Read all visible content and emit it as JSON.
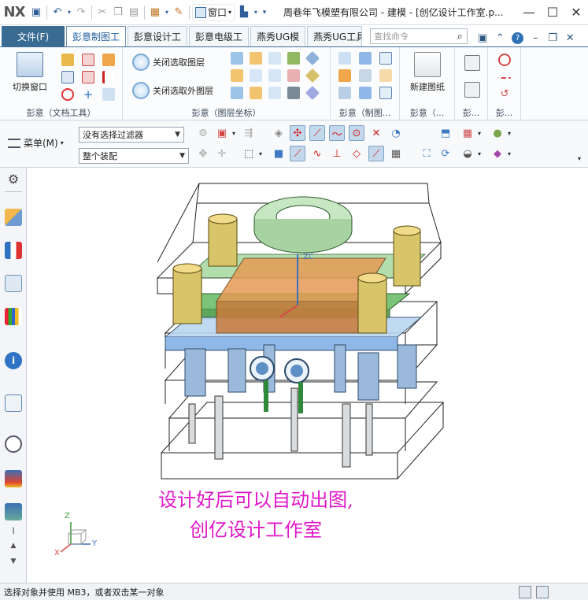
{
  "titlebar": {
    "logo": "NX",
    "window_menu": "窗口",
    "title": "周巷年飞模塑有限公司 - 建模 - [创亿设计工作室.p...",
    "min": "—",
    "max": "☐",
    "close": "✕"
  },
  "tabs": {
    "file": "文件(F)",
    "items": [
      "彭意制图工",
      "彭意设计工",
      "彭意电级工",
      "燕秀UG模",
      "燕秀UG工具"
    ],
    "search_placeholder": "查找命令"
  },
  "ribbon": {
    "switch_window": "切换窗口",
    "close_selected_layer": "关闭选取图层",
    "close_other_layers": "关闭选取外图层",
    "new_drawing": "新建图纸",
    "groups": [
      "彭意（文档工具）",
      "彭意（图层坐标）",
      "彭意（制图...",
      "彭意（...",
      "彭...",
      "彭..."
    ]
  },
  "toolbar2": {
    "menu_label": "菜单(M)",
    "filter_value": "没有选择过滤器",
    "assembly_value": "整个装配"
  },
  "canvas": {
    "overlay_line1": "设计好后可以自动出图,",
    "overlay_line2": "创亿设计工作室",
    "axis_z": "Z",
    "axis_y": "Y",
    "axis_x": "X",
    "zc_label": "ZC"
  },
  "statusbar": {
    "message": "选择对象并使用 MB3，或者双击某一对象"
  },
  "colors": {
    "file_tab": "#3a6b93",
    "overlay_text": "#e018c8",
    "mold_green": "#7cc47a",
    "mold_orange": "#e59a55",
    "mold_blue": "#8fb8e8"
  }
}
